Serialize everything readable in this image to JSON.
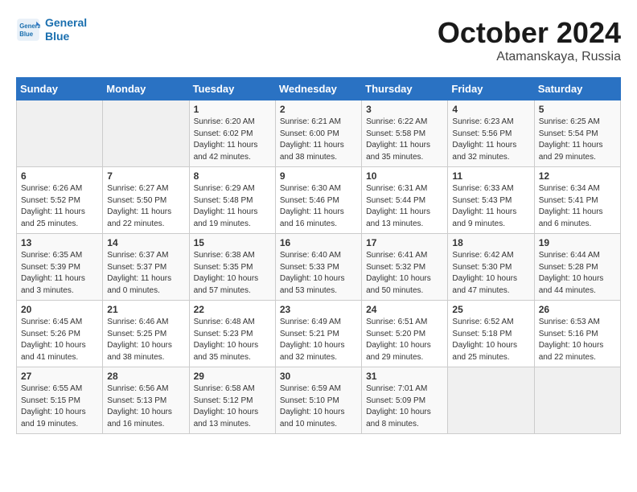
{
  "header": {
    "logo_line1": "General",
    "logo_line2": "Blue",
    "title": "October 2024",
    "subtitle": "Atamanskaya, Russia"
  },
  "weekdays": [
    "Sunday",
    "Monday",
    "Tuesday",
    "Wednesday",
    "Thursday",
    "Friday",
    "Saturday"
  ],
  "weeks": [
    [
      {
        "day": "",
        "sunrise": "",
        "sunset": "",
        "daylight": ""
      },
      {
        "day": "",
        "sunrise": "",
        "sunset": "",
        "daylight": ""
      },
      {
        "day": "1",
        "sunrise": "Sunrise: 6:20 AM",
        "sunset": "Sunset: 6:02 PM",
        "daylight": "Daylight: 11 hours and 42 minutes."
      },
      {
        "day": "2",
        "sunrise": "Sunrise: 6:21 AM",
        "sunset": "Sunset: 6:00 PM",
        "daylight": "Daylight: 11 hours and 38 minutes."
      },
      {
        "day": "3",
        "sunrise": "Sunrise: 6:22 AM",
        "sunset": "Sunset: 5:58 PM",
        "daylight": "Daylight: 11 hours and 35 minutes."
      },
      {
        "day": "4",
        "sunrise": "Sunrise: 6:23 AM",
        "sunset": "Sunset: 5:56 PM",
        "daylight": "Daylight: 11 hours and 32 minutes."
      },
      {
        "day": "5",
        "sunrise": "Sunrise: 6:25 AM",
        "sunset": "Sunset: 5:54 PM",
        "daylight": "Daylight: 11 hours and 29 minutes."
      }
    ],
    [
      {
        "day": "6",
        "sunrise": "Sunrise: 6:26 AM",
        "sunset": "Sunset: 5:52 PM",
        "daylight": "Daylight: 11 hours and 25 minutes."
      },
      {
        "day": "7",
        "sunrise": "Sunrise: 6:27 AM",
        "sunset": "Sunset: 5:50 PM",
        "daylight": "Daylight: 11 hours and 22 minutes."
      },
      {
        "day": "8",
        "sunrise": "Sunrise: 6:29 AM",
        "sunset": "Sunset: 5:48 PM",
        "daylight": "Daylight: 11 hours and 19 minutes."
      },
      {
        "day": "9",
        "sunrise": "Sunrise: 6:30 AM",
        "sunset": "Sunset: 5:46 PM",
        "daylight": "Daylight: 11 hours and 16 minutes."
      },
      {
        "day": "10",
        "sunrise": "Sunrise: 6:31 AM",
        "sunset": "Sunset: 5:44 PM",
        "daylight": "Daylight: 11 hours and 13 minutes."
      },
      {
        "day": "11",
        "sunrise": "Sunrise: 6:33 AM",
        "sunset": "Sunset: 5:43 PM",
        "daylight": "Daylight: 11 hours and 9 minutes."
      },
      {
        "day": "12",
        "sunrise": "Sunrise: 6:34 AM",
        "sunset": "Sunset: 5:41 PM",
        "daylight": "Daylight: 11 hours and 6 minutes."
      }
    ],
    [
      {
        "day": "13",
        "sunrise": "Sunrise: 6:35 AM",
        "sunset": "Sunset: 5:39 PM",
        "daylight": "Daylight: 11 hours and 3 minutes."
      },
      {
        "day": "14",
        "sunrise": "Sunrise: 6:37 AM",
        "sunset": "Sunset: 5:37 PM",
        "daylight": "Daylight: 11 hours and 0 minutes."
      },
      {
        "day": "15",
        "sunrise": "Sunrise: 6:38 AM",
        "sunset": "Sunset: 5:35 PM",
        "daylight": "Daylight: 10 hours and 57 minutes."
      },
      {
        "day": "16",
        "sunrise": "Sunrise: 6:40 AM",
        "sunset": "Sunset: 5:33 PM",
        "daylight": "Daylight: 10 hours and 53 minutes."
      },
      {
        "day": "17",
        "sunrise": "Sunrise: 6:41 AM",
        "sunset": "Sunset: 5:32 PM",
        "daylight": "Daylight: 10 hours and 50 minutes."
      },
      {
        "day": "18",
        "sunrise": "Sunrise: 6:42 AM",
        "sunset": "Sunset: 5:30 PM",
        "daylight": "Daylight: 10 hours and 47 minutes."
      },
      {
        "day": "19",
        "sunrise": "Sunrise: 6:44 AM",
        "sunset": "Sunset: 5:28 PM",
        "daylight": "Daylight: 10 hours and 44 minutes."
      }
    ],
    [
      {
        "day": "20",
        "sunrise": "Sunrise: 6:45 AM",
        "sunset": "Sunset: 5:26 PM",
        "daylight": "Daylight: 10 hours and 41 minutes."
      },
      {
        "day": "21",
        "sunrise": "Sunrise: 6:46 AM",
        "sunset": "Sunset: 5:25 PM",
        "daylight": "Daylight: 10 hours and 38 minutes."
      },
      {
        "day": "22",
        "sunrise": "Sunrise: 6:48 AM",
        "sunset": "Sunset: 5:23 PM",
        "daylight": "Daylight: 10 hours and 35 minutes."
      },
      {
        "day": "23",
        "sunrise": "Sunrise: 6:49 AM",
        "sunset": "Sunset: 5:21 PM",
        "daylight": "Daylight: 10 hours and 32 minutes."
      },
      {
        "day": "24",
        "sunrise": "Sunrise: 6:51 AM",
        "sunset": "Sunset: 5:20 PM",
        "daylight": "Daylight: 10 hours and 29 minutes."
      },
      {
        "day": "25",
        "sunrise": "Sunrise: 6:52 AM",
        "sunset": "Sunset: 5:18 PM",
        "daylight": "Daylight: 10 hours and 25 minutes."
      },
      {
        "day": "26",
        "sunrise": "Sunrise: 6:53 AM",
        "sunset": "Sunset: 5:16 PM",
        "daylight": "Daylight: 10 hours and 22 minutes."
      }
    ],
    [
      {
        "day": "27",
        "sunrise": "Sunrise: 6:55 AM",
        "sunset": "Sunset: 5:15 PM",
        "daylight": "Daylight: 10 hours and 19 minutes."
      },
      {
        "day": "28",
        "sunrise": "Sunrise: 6:56 AM",
        "sunset": "Sunset: 5:13 PM",
        "daylight": "Daylight: 10 hours and 16 minutes."
      },
      {
        "day": "29",
        "sunrise": "Sunrise: 6:58 AM",
        "sunset": "Sunset: 5:12 PM",
        "daylight": "Daylight: 10 hours and 13 minutes."
      },
      {
        "day": "30",
        "sunrise": "Sunrise: 6:59 AM",
        "sunset": "Sunset: 5:10 PM",
        "daylight": "Daylight: 10 hours and 10 minutes."
      },
      {
        "day": "31",
        "sunrise": "Sunrise: 7:01 AM",
        "sunset": "Sunset: 5:09 PM",
        "daylight": "Daylight: 10 hours and 8 minutes."
      },
      {
        "day": "",
        "sunrise": "",
        "sunset": "",
        "daylight": ""
      },
      {
        "day": "",
        "sunrise": "",
        "sunset": "",
        "daylight": ""
      }
    ]
  ]
}
